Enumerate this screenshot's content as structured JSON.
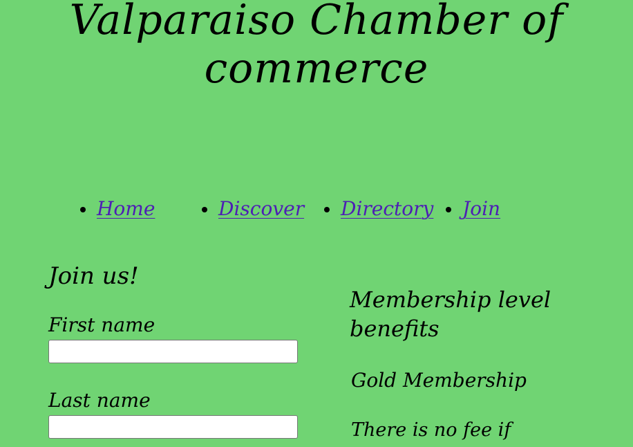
{
  "header": {
    "title": "Valparaiso Chamber of commerce"
  },
  "nav": {
    "items": [
      {
        "label": "Home"
      },
      {
        "label": "Discover"
      },
      {
        "label": "Directory"
      },
      {
        "label": "Join"
      }
    ]
  },
  "join_form": {
    "heading": "Join us!",
    "first_name_label": "First name",
    "first_name_value": "",
    "last_name_label": "Last name",
    "last_name_value": ""
  },
  "benefits": {
    "heading": "Membership level benefits",
    "gold_heading": "Gold Membership",
    "gold_text": "There is no fee if"
  }
}
